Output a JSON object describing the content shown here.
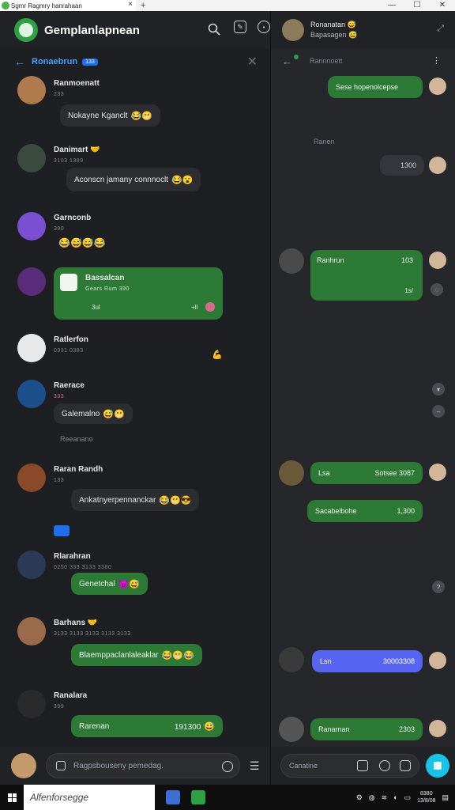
{
  "window": {
    "tab_title": "Sgmr Ragmry hanrahaan",
    "close": "×",
    "new_tab": "+",
    "min": "—",
    "max": "☐",
    "win_close": "✕"
  },
  "left": {
    "app_title": "Gemplanlapnean",
    "thread_title": "Ronaebrun",
    "thread_badge": "133",
    "thread_close": "✕",
    "messages": [
      {
        "name": "Ranmoenatt",
        "sub": "233",
        "text": "Nokayne Kganclt",
        "emoji": "😂😬"
      },
      {
        "name": "Danimart 🤝",
        "sub": "3103 1389",
        "text": "Aconscn jamany connnoclt",
        "emoji": "😂😮"
      },
      {
        "name": "Garnconb",
        "sub": "390",
        "text": "",
        "emoji": "😂😅😅😂"
      },
      {
        "name": "Bassalcan",
        "sub": "Gears Rum 390",
        "text": "",
        "emoji": "",
        "card_left": "3ul",
        "card_right": "+ll"
      },
      {
        "name": "Ratlerfon",
        "sub": "0331 0383",
        "text": "",
        "emoji": "💪"
      },
      {
        "name": "Raerace",
        "sub": "333",
        "text": "Galemalno",
        "emoji": "😅😬",
        "extra": "Reeanano"
      },
      {
        "name": "Raran Randh",
        "sub": "133",
        "text": "Ankatnyerpennanckar",
        "emoji": "😂😬😎"
      },
      {
        "name": "Rlarahran",
        "sub": "0250 333 3133 3380",
        "text": "Genetchal",
        "emoji": "😈😅"
      },
      {
        "name": "Barhans 🤝",
        "sub": "3133 3133 3133 3133 3133",
        "text": "Blaemppaclanlaleaklar",
        "emoji": "😂😬😂"
      },
      {
        "name": "Ranalara",
        "sub": "399",
        "text": "Rarenan",
        "emoji": "😅",
        "time": "191300"
      }
    ],
    "compose_placeholder": "Ragpsbouseny pemedag."
  },
  "right": {
    "title_line1": "Ronanatan 😅",
    "title_line2": "Bapasagen 😅",
    "subtitle": "Rannnoett",
    "label_1": "Ranen",
    "messages": [
      {
        "text": "Sese hopenolcepse",
        "kind": "green"
      },
      {
        "text": "1300",
        "kind": "dark"
      },
      {
        "text": "Ranhrun",
        "time": "103",
        "foot": "1s/",
        "kind": "green"
      },
      {
        "text": "Lsa",
        "time": "Sotsee 3087",
        "kind": "green"
      },
      {
        "text": "Sacabelbohe",
        "time": "1,300",
        "kind": "green"
      },
      {
        "text": "Lsn",
        "time": "30003308",
        "kind": "blue"
      },
      {
        "text": "Ranarnan",
        "time": "2303",
        "kind": "green"
      }
    ],
    "compose_placeholder": "Canatine"
  },
  "taskbar": {
    "search_placeholder": "Alfenforsegge",
    "time": "8380",
    "date": "13/8/08"
  },
  "colors": {
    "accent_green": "#2d7a36",
    "accent_blue": "#4a9eff",
    "send_cyan": "#17c3e6",
    "bubble_blue": "#5865f2"
  }
}
